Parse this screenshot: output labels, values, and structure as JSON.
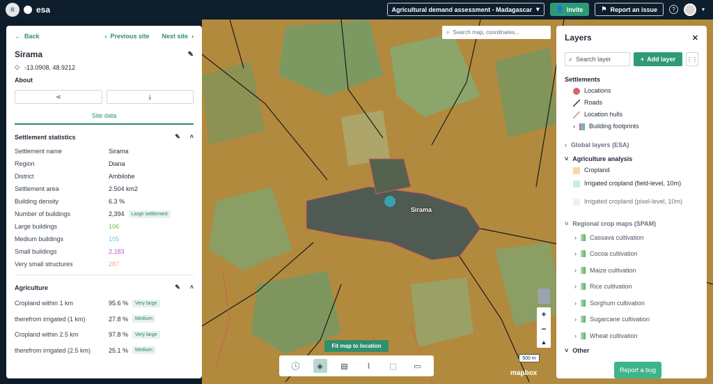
{
  "topbar": {
    "org": "esa",
    "project": "Agricultural demand assessment - Madagascar",
    "invite": "Invite",
    "report_issue": "Report an issue",
    "help": "?"
  },
  "left": {
    "back": "Back",
    "prev": "Previous site",
    "next": "Next site",
    "site_name": "Sirama",
    "coords": "-13.0908, 48.9212",
    "about": "About",
    "tab": "Site data",
    "settlement": {
      "title": "Settlement statistics",
      "rows": [
        {
          "k": "Settlement name",
          "v": "Sirama"
        },
        {
          "k": "Region",
          "v": "Diana"
        },
        {
          "k": "District",
          "v": "Ambilobe"
        },
        {
          "k": "Settlement area",
          "v": "2.504 km2"
        },
        {
          "k": "Building density",
          "v": "6.3 %"
        },
        {
          "k": "Number of buildings",
          "v": "2,394",
          "badge": "Large settlement"
        },
        {
          "k": "Large buildings",
          "v": "106",
          "color": "#5cbf3f"
        },
        {
          "k": "Medium buildings",
          "v": "105",
          "color": "#7fbcd8"
        },
        {
          "k": "Small buildings",
          "v": "2,183",
          "color": "#c84fd1"
        },
        {
          "k": "Very small structures",
          "v": "287",
          "color": "#f0a890"
        }
      ]
    },
    "agriculture": {
      "title": "Agriculture",
      "rows": [
        {
          "k": "Cropland within 1 km",
          "v": "95.6 %",
          "badge": "Very large"
        },
        {
          "k": "therefrom irrigated (1 km)",
          "v": "27.8 %",
          "badge": "Medium"
        },
        {
          "k": "Cropland within 2.5 km",
          "v": "97.8 %",
          "badge": "Very large"
        },
        {
          "k": "therefrom irrigated (2.5 km)",
          "v": "25.1 %",
          "badge": "Medium"
        }
      ]
    }
  },
  "map": {
    "search_placeholder": "Search map, coordinates...",
    "label": "Sirama",
    "fit": "Fit map to location",
    "scale": "500 m",
    "attribution": "mapbox"
  },
  "layers": {
    "title": "Layers",
    "search": "Search layer",
    "add": "Add layer",
    "settlements": "Settlements",
    "settlement_items": [
      "Locations",
      "Roads",
      "Location hulls",
      "Building footprints"
    ],
    "global": "Global layers (ESA)",
    "agri": "Agriculture analysis",
    "agri_items": [
      "Cropland",
      "Irrigated cropland (field-level, 10m)",
      "Irrigated cropland (pixel-level, 10m)"
    ],
    "regional": "Regional crop maps (SPAM)",
    "crops": [
      "Cassava cultivation",
      "Cocoa cultivation",
      "Maize cultivation",
      "Rice cultivation",
      "Sorghum cultivation",
      "Sugarcane cultivation",
      "Wheat cultivation"
    ],
    "other": "Other",
    "report_bug": "Report a bug"
  }
}
